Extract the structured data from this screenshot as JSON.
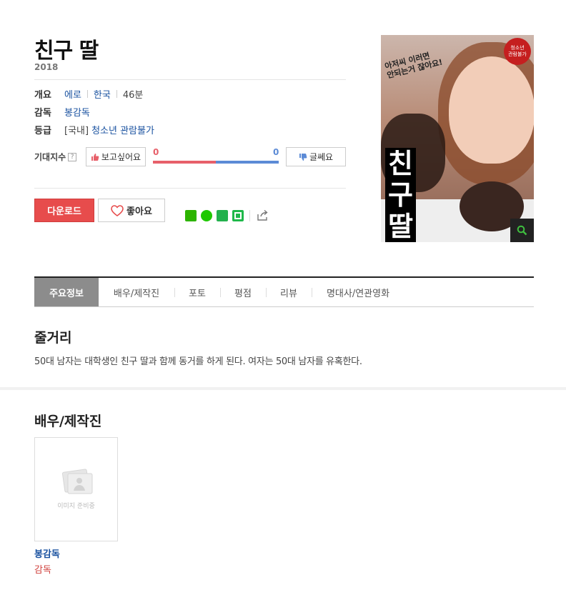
{
  "movie": {
    "title": "친구 딸",
    "year": "2018"
  },
  "info": {
    "summary_label": "개요",
    "genre": "에로",
    "country": "한국",
    "runtime": "46분",
    "director_label": "감독",
    "director": "봉감독",
    "rating_label": "등급",
    "rating_prefix": "[국내]",
    "rating": "청소년 관람불가"
  },
  "expectation": {
    "label": "기대지수",
    "help": "?",
    "want_label": "보고싶어요",
    "meh_label": "글쎄요",
    "want_count": "0",
    "meh_count": "0",
    "want_fraction": 0.5,
    "colors": {
      "want": "#e7606a",
      "meh": "#5c8bd6"
    }
  },
  "actions": {
    "download_label": "다운로드",
    "like_label": "좋아요",
    "share_icons": [
      "blog-icon",
      "cafe-icon",
      "bookmark-icon",
      "band-icon",
      "share-icon"
    ]
  },
  "poster": {
    "tagline_line1": "아저씨 이러면",
    "tagline_line2": "안되는거 잖아요!",
    "title_line1": "친",
    "title_line2": "구",
    "title_line3": "딸",
    "badge_line1": "청소년",
    "badge_line2": "관람불가"
  },
  "tabs": [
    {
      "label": "주요정보"
    },
    {
      "label": "배우/제작진"
    },
    {
      "label": "포토"
    },
    {
      "label": "평점"
    },
    {
      "label": "리뷰"
    },
    {
      "label": "명대사/연관영화"
    }
  ],
  "plot": {
    "heading": "줄거리",
    "text": "50대 남자는 대학생인 친구 딸과 함께 동거를 하게 된다. 여자는 50대 남자를 유혹한다."
  },
  "cast": {
    "heading": "배우/제작진",
    "placeholder": "이미지 준비중",
    "members": [
      {
        "name": "봉감독",
        "role": "감독"
      }
    ]
  },
  "colors": {
    "accent_red": "#e74c4c",
    "link_blue": "#1a52a0",
    "active_tab": "#8c8c8c"
  }
}
